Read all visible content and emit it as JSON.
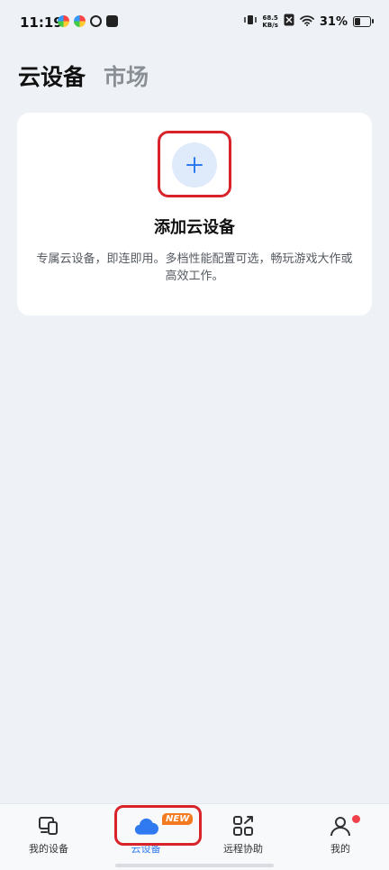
{
  "status_bar": {
    "time": "11:19",
    "net_speed_value": "68.5",
    "net_speed_unit": "KB/s",
    "battery_percent": "31%",
    "battery_level": 0.31
  },
  "header": {
    "tabs": [
      {
        "label": "云设备",
        "active": true
      },
      {
        "label": "市场",
        "active": false
      }
    ]
  },
  "card": {
    "add_icon": "plus-icon",
    "title": "添加云设备",
    "description": "专属云设备，即连即用。多档性能配置可选，畅玩游戏大作或高效工作。"
  },
  "bottom_nav": {
    "items": [
      {
        "label": "我的设备",
        "icon": "devices-icon"
      },
      {
        "label": "云设备",
        "icon": "cloud-icon",
        "active": true,
        "badge": "NEW"
      },
      {
        "label": "远程协助",
        "icon": "remote-assist-icon"
      },
      {
        "label": "我的",
        "icon": "profile-icon",
        "notification_dot": true
      }
    ]
  },
  "colors": {
    "accent": "#2f7af0",
    "badge": "#f47a1f",
    "highlight_outline": "#d9232a",
    "background": "#eef2f6"
  }
}
